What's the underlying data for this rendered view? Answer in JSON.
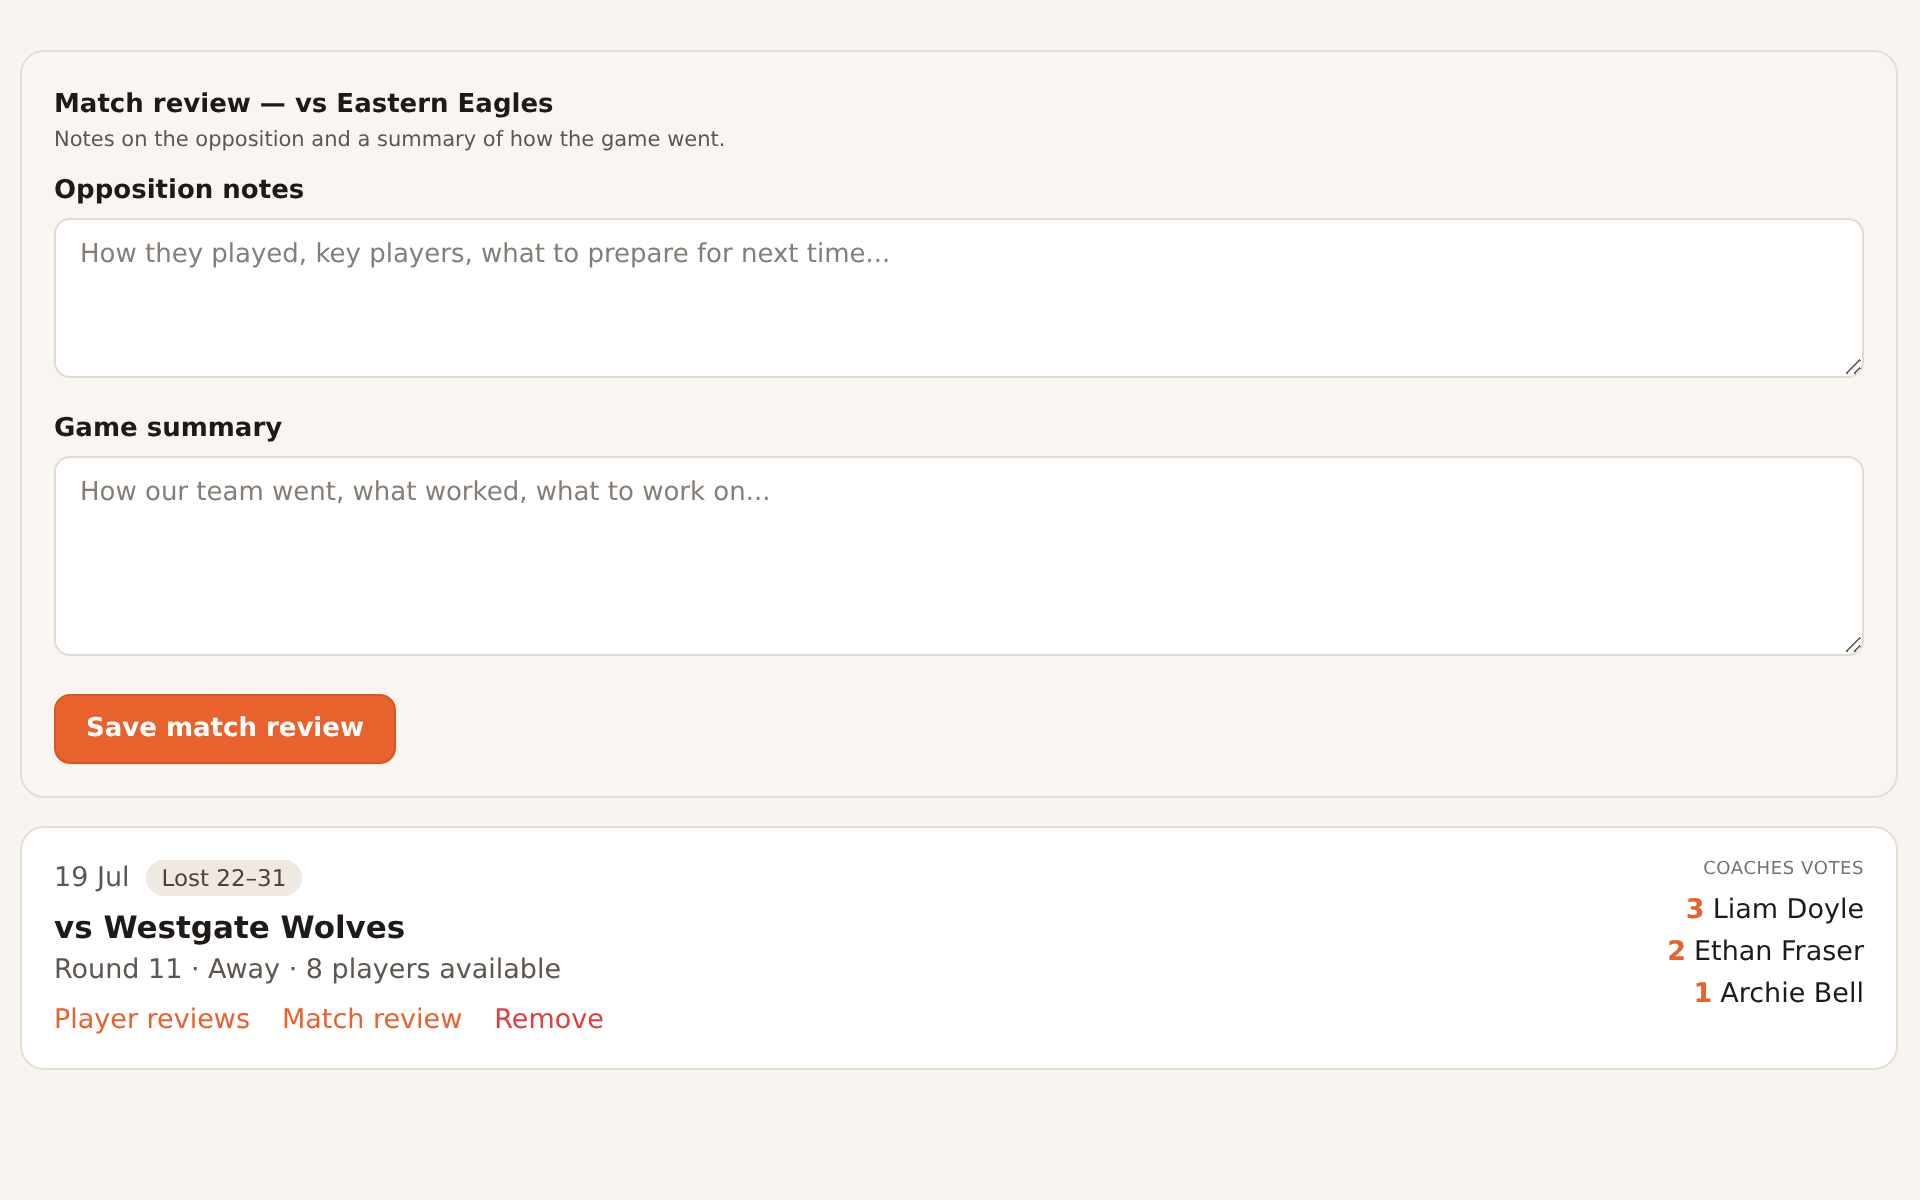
{
  "review_form": {
    "title": "Match review — vs Eastern Eagles",
    "subtitle": "Notes on the opposition and a summary of how the game went.",
    "fields": [
      {
        "label": "Opposition notes",
        "placeholder": "How they played, key players, what to prepare for next time..."
      },
      {
        "label": "Game summary",
        "placeholder": "How our team went, what worked, what to work on..."
      }
    ],
    "save_button": "Save match review"
  },
  "match_card": {
    "date": "19 Jul",
    "result": "Lost 22–31",
    "title": "vs Westgate Wolves",
    "details": "Round 11 · Away · 8 players available",
    "actions": [
      {
        "label": "Player reviews",
        "kind": "normal"
      },
      {
        "label": "Match review",
        "kind": "normal"
      },
      {
        "label": "Remove",
        "kind": "danger"
      }
    ],
    "votes_heading": "COACHES VOTES",
    "votes": [
      {
        "points": "3",
        "name": "Liam Doyle"
      },
      {
        "points": "2",
        "name": "Ethan Fraser"
      },
      {
        "points": "1",
        "name": "Archie Bell"
      }
    ]
  }
}
